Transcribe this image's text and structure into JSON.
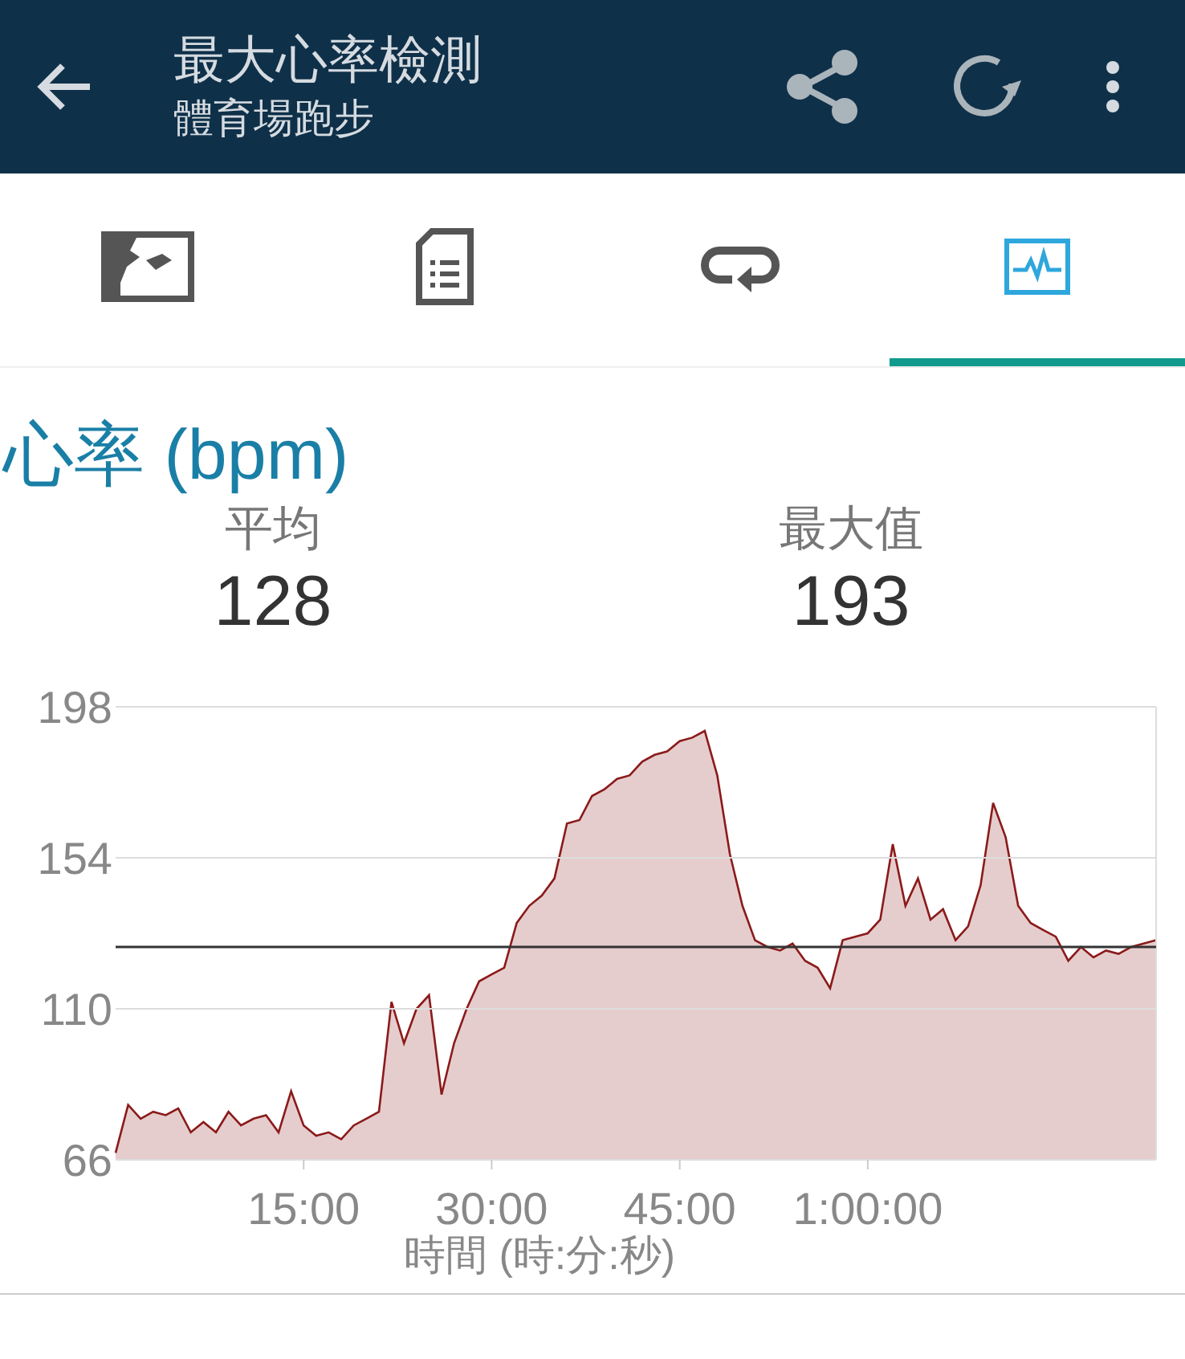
{
  "header": {
    "title": "最大心率檢測",
    "subtitle": "體育場跑步"
  },
  "tabs": [
    {
      "kind": "map",
      "selected": false
    },
    {
      "kind": "sheet",
      "selected": false
    },
    {
      "kind": "repeat",
      "selected": false
    },
    {
      "kind": "chart",
      "selected": true
    }
  ],
  "section_title": "心率 (bpm)",
  "stats": [
    {
      "label": "平均",
      "value": "128"
    },
    {
      "label": "最大值",
      "value": "193"
    }
  ],
  "chart_data": {
    "type": "area",
    "xlabel": "時間 (時:分:秒)",
    "xlim": [
      0,
      83
    ],
    "ylim": [
      66,
      198
    ],
    "xticks": [
      {
        "value": 15,
        "label": "15:00"
      },
      {
        "value": 30,
        "label": "30:00"
      },
      {
        "value": 45,
        "label": "45:00"
      },
      {
        "value": 60,
        "label": "1:00:00"
      }
    ],
    "yticks": [
      66,
      110,
      154,
      198
    ],
    "x": [
      0,
      1,
      2,
      3,
      4,
      5,
      6,
      7,
      8,
      9,
      10,
      11,
      12,
      13,
      14,
      15,
      16,
      17,
      18,
      19,
      20,
      21,
      22,
      23,
      24,
      25,
      26,
      27,
      28,
      29,
      30,
      31,
      32,
      33,
      34,
      35,
      36,
      37,
      38,
      39,
      40,
      41,
      42,
      43,
      44,
      45,
      46,
      47,
      48,
      49,
      50,
      51,
      52,
      53,
      54,
      55,
      56,
      57,
      58,
      59,
      60,
      61,
      62,
      63,
      64,
      65,
      66,
      67,
      68,
      69,
      70,
      71,
      72,
      73,
      74,
      75,
      76,
      77,
      78,
      79,
      80,
      81,
      82,
      83
    ],
    "series": [
      {
        "color": "#8b1a1a",
        "values": [
          68,
          82,
          78,
          80,
          79,
          81,
          74,
          77,
          74,
          80,
          76,
          78,
          79,
          74,
          86,
          76,
          73,
          74,
          72,
          76,
          78,
          80,
          112,
          100,
          110,
          114,
          85,
          100,
          110,
          118,
          120,
          122,
          135,
          140,
          143,
          148,
          164,
          165,
          172,
          174,
          177,
          178,
          182,
          184,
          185,
          188,
          189,
          191,
          178,
          155,
          140,
          130,
          128,
          127,
          129,
          124,
          122,
          116,
          130,
          131,
          132,
          136,
          158,
          140,
          148,
          136,
          139,
          130,
          134,
          146,
          170,
          160,
          140,
          135,
          133,
          131,
          124,
          128,
          125,
          127,
          126,
          128,
          129,
          130
        ]
      }
    ],
    "ref_lines": [
      {
        "axis": "y",
        "value": 128,
        "color": "#333333"
      }
    ]
  }
}
